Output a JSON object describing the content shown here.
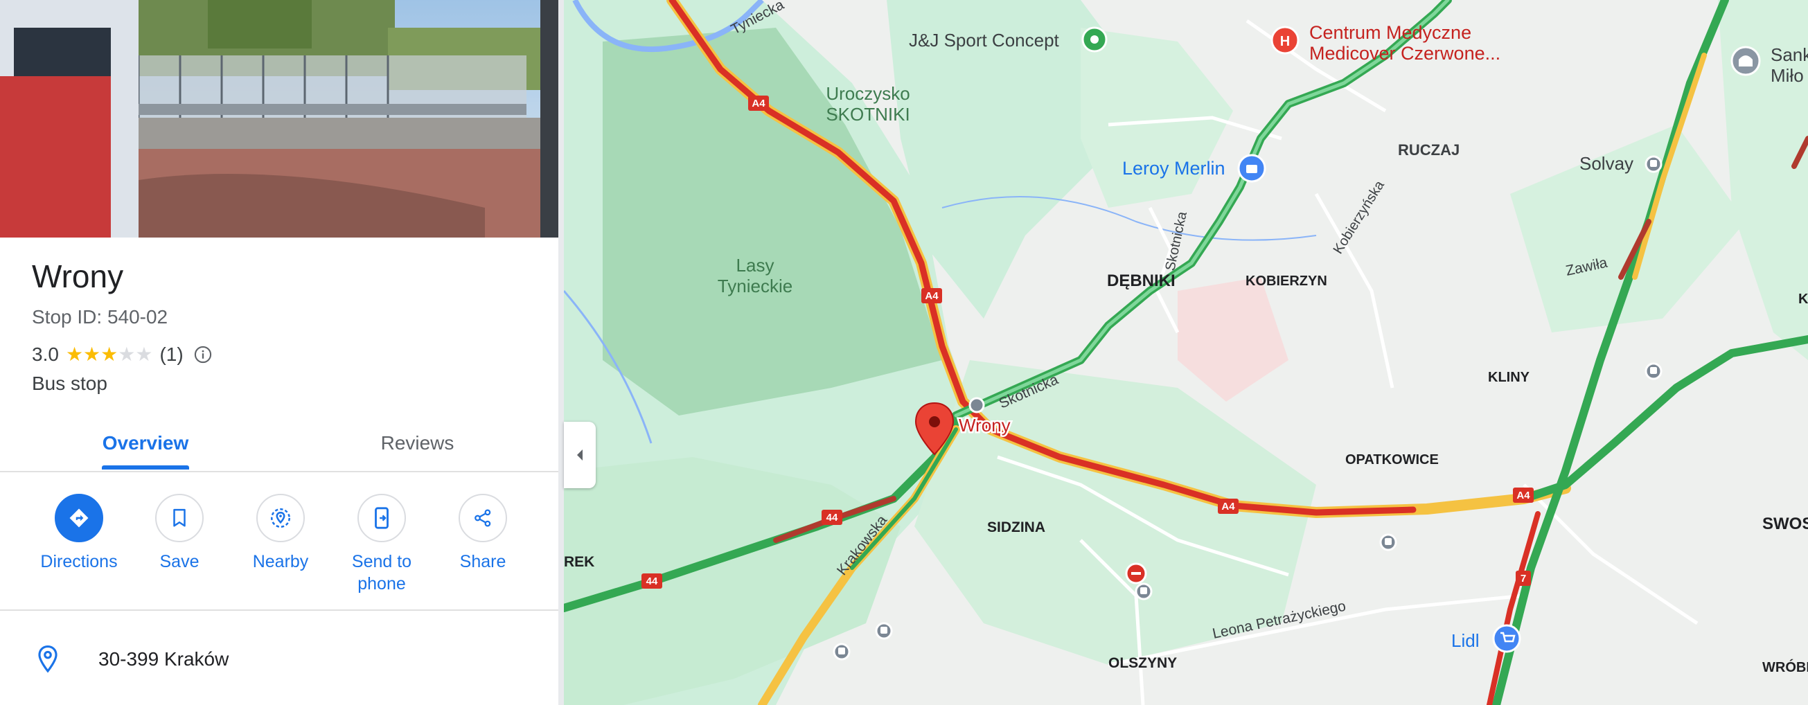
{
  "place": {
    "name": "Wrony",
    "stop_id": "Stop ID: 540-02",
    "rating": "3.0",
    "stars_filled": 3,
    "stars_total": 5,
    "review_count": "(1)",
    "category": "Bus stop"
  },
  "tabs": [
    {
      "label": "Overview",
      "active": true
    },
    {
      "label": "Reviews",
      "active": false
    }
  ],
  "actions": [
    {
      "label": "Directions",
      "icon": "directions-icon"
    },
    {
      "label": "Save",
      "icon": "bookmark-icon"
    },
    {
      "label": "Nearby",
      "icon": "nearby-icon"
    },
    {
      "label": "Send to\nphone",
      "icon": "send-to-phone-icon"
    },
    {
      "label": "Share",
      "icon": "share-icon"
    }
  ],
  "address": "30-399 Kraków",
  "map": {
    "marker_label": "Wrony",
    "labels": {
      "tyniecka": "Tyniecka",
      "jj_sport": "J&J Sport Concept",
      "centrum_1": "Centrum Medyczne",
      "centrum_2": "Medicover Czerwone...",
      "sank": "Sank",
      "milo": "Miło",
      "uroczysko_1": "Uroczysko",
      "uroczysko_2": "SKOTNIKI",
      "leroy": "Leroy Merlin",
      "ruczaj": "RUCZAJ",
      "solvay": "Solvay",
      "lasy_1": "Lasy",
      "lasy_2": "Tynieckie",
      "skotnicka_v": "Skotnicka",
      "kobierzynska": "Kobierzyńska",
      "zawila": "Zawiła",
      "debniki": "DĘBNIKI",
      "kobierzyn": "KOBIERZYN",
      "kliny": "KLINY",
      "skotnicka_2": "Skotnicka",
      "opatkowice": "OPATKOWICE",
      "sidzina": "SIDZINA",
      "krakowska": "Krakowska",
      "rek": "REK",
      "swos": "SWOS",
      "leona": "Leona Petrażyckiego",
      "lidl": "Lidl",
      "olszyny": "OLSZYNY",
      "wrobl": "WRÓBL",
      "k_edge": "K",
      "a4": "A4",
      "r44": "44",
      "r7": "7"
    },
    "colors": {
      "park": "#c8ecd4",
      "park_dark": "#a9dcb8",
      "land": "#f1f3f4",
      "water": "#8ab4f8",
      "traffic_red": "#d93025",
      "traffic_yellow": "#f5c242",
      "traffic_green": "#34a853"
    }
  }
}
